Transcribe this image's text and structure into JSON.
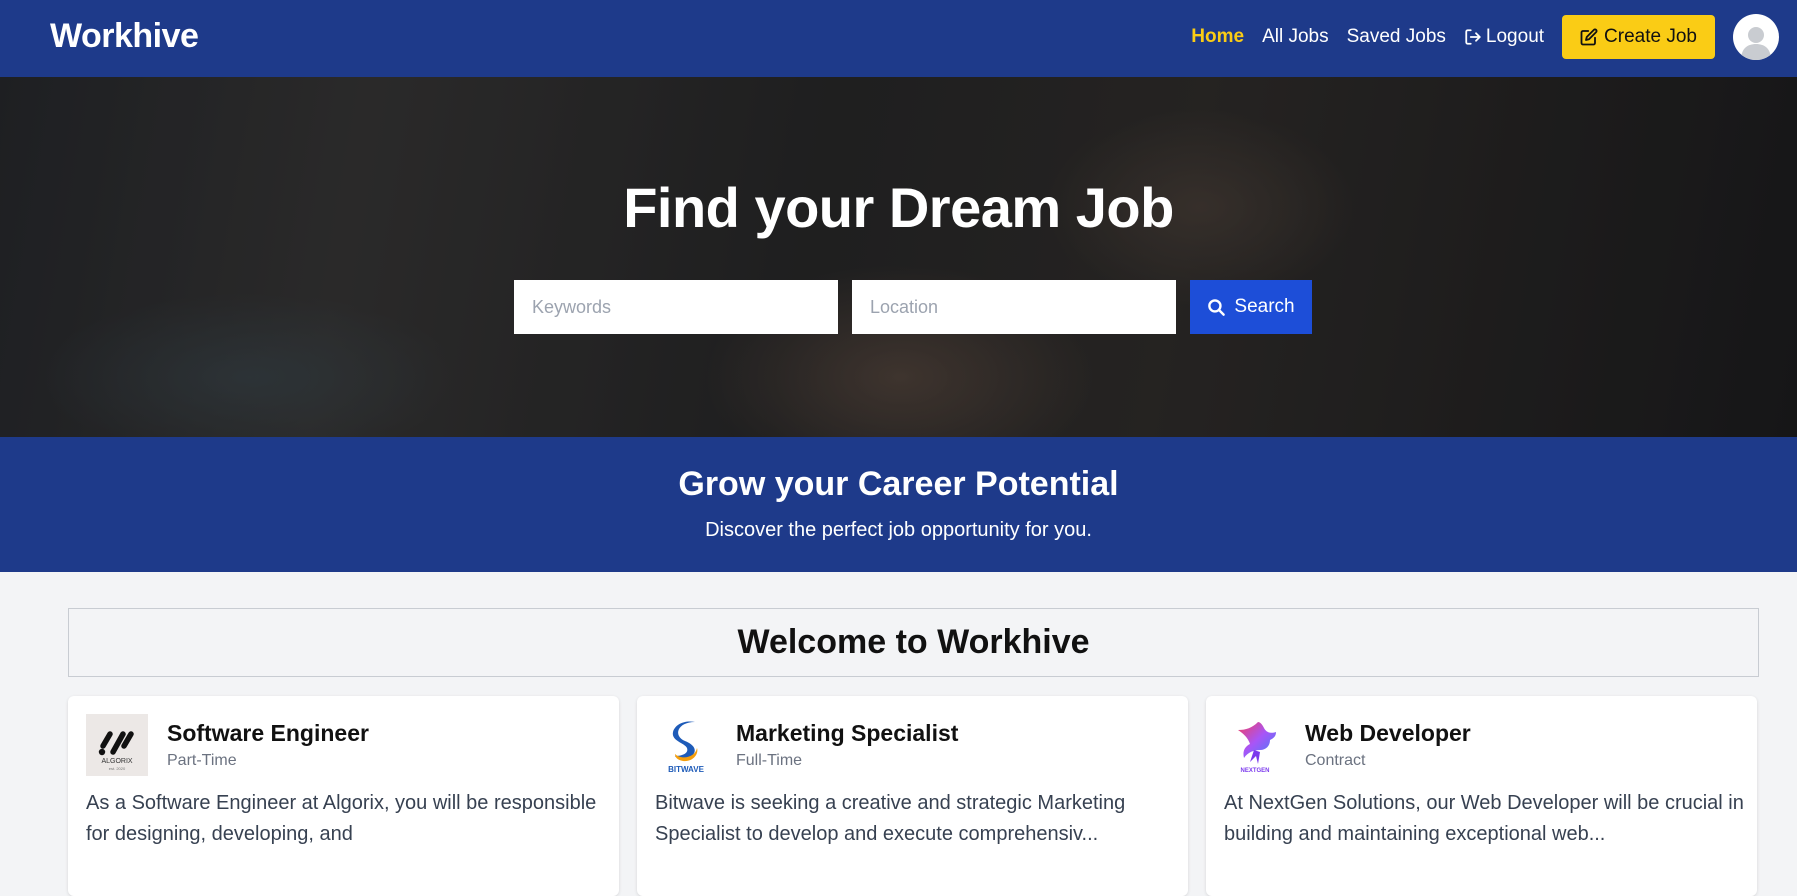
{
  "header": {
    "brand": "Workhive",
    "nav": {
      "home": "Home",
      "all_jobs": "All Jobs",
      "saved_jobs": "Saved Jobs",
      "logout": "Logout",
      "create_job": "Create Job"
    },
    "colors": {
      "bar": "#1e3a8a",
      "accent": "#facc15"
    }
  },
  "hero": {
    "title": "Find your Dream Job",
    "keywords_placeholder": "Keywords",
    "location_placeholder": "Location",
    "search_label": "Search",
    "search_button_color": "#1d4ed8"
  },
  "banner": {
    "title": "Grow your Career Potential",
    "subtitle": "Discover the perfect job opportunity for you."
  },
  "welcome": {
    "title": "Welcome to Workhive"
  },
  "jobs": [
    {
      "title": "Software Engineer",
      "type": "Part-Time",
      "logo": "ALGORIX",
      "logo_tagline": "est. 2020",
      "description": "As a Software Engineer at Algorix, you will be responsible for designing, developing, and"
    },
    {
      "title": "Marketing Specialist",
      "type": "Full-Time",
      "logo": "BITWAVE",
      "description": "Bitwave is seeking a creative and strategic Marketing Specialist to develop and execute comprehensiv..."
    },
    {
      "title": "Web Developer",
      "type": "Contract",
      "logo": "NEXTGEN",
      "description": "At NextGen Solutions, our Web Developer will be crucial in building and maintaining exceptional web..."
    }
  ]
}
